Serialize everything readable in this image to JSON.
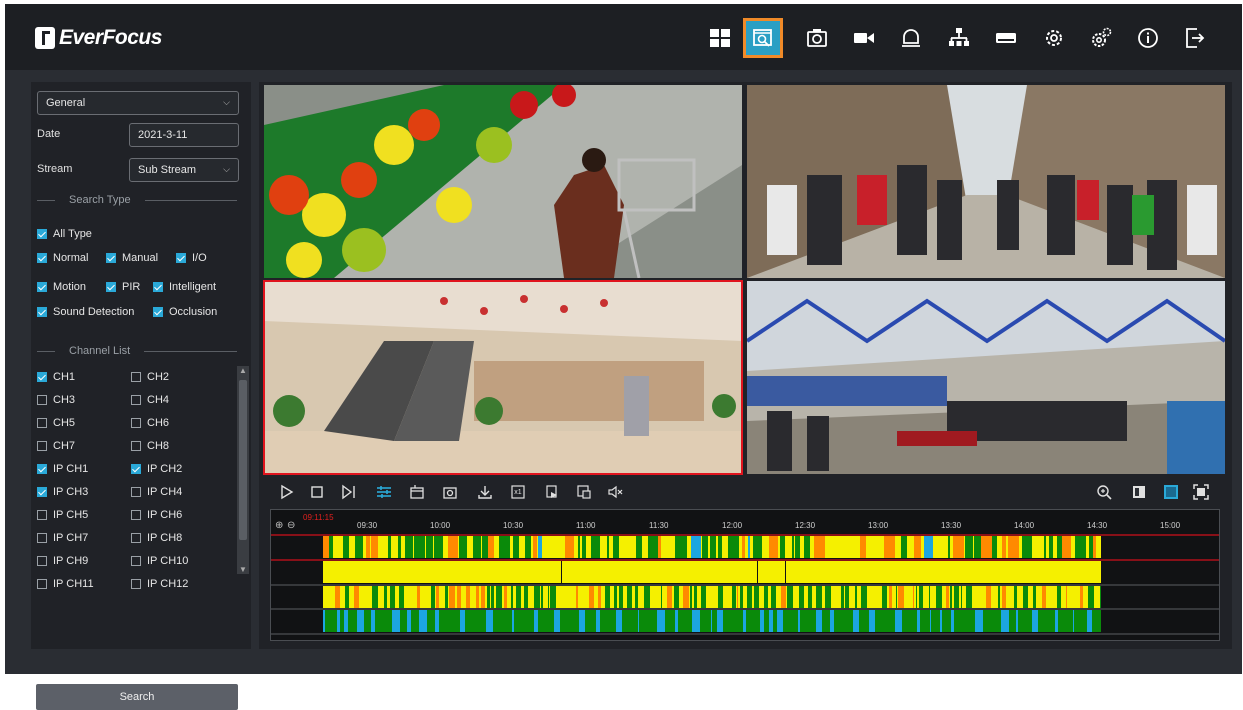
{
  "brand": {
    "name": "EverFocus"
  },
  "nav": {
    "icons": [
      "layout-icon",
      "playback-icon",
      "snapshot-icon",
      "record-icon",
      "alarm-icon",
      "network-icon",
      "storage-icon",
      "settings-icon",
      "advanced-settings-icon",
      "info-icon",
      "logout-icon"
    ],
    "active": "playback-icon",
    "active_color": "#2a9fc4",
    "highlight_color": "#f08a28"
  },
  "sidebar": {
    "mode": "General",
    "date_label": "Date",
    "date_value": "2021-3-11",
    "stream_label": "Stream",
    "stream_value": "Sub Stream",
    "search_type_header": "Search Type",
    "all_type": "All Type",
    "types": [
      {
        "label": "Normal",
        "checked": true
      },
      {
        "label": "Manual",
        "checked": true
      },
      {
        "label": "I/O",
        "checked": true
      },
      {
        "label": "Motion",
        "checked": true
      },
      {
        "label": "PIR",
        "checked": true
      },
      {
        "label": "Intelligent",
        "checked": true
      },
      {
        "label": "Sound Detection",
        "checked": true
      },
      {
        "label": "Occlusion",
        "checked": true
      }
    ],
    "channel_header": "Channel List",
    "channels": [
      {
        "label": "CH1",
        "checked": true
      },
      {
        "label": "CH2",
        "checked": false
      },
      {
        "label": "CH3",
        "checked": false
      },
      {
        "label": "CH4",
        "checked": false
      },
      {
        "label": "CH5",
        "checked": false
      },
      {
        "label": "CH6",
        "checked": false
      },
      {
        "label": "CH7",
        "checked": false
      },
      {
        "label": "CH8",
        "checked": false
      },
      {
        "label": "IP CH1",
        "checked": true
      },
      {
        "label": "IP CH2",
        "checked": true
      },
      {
        "label": "IP CH3",
        "checked": true
      },
      {
        "label": "IP CH4",
        "checked": false
      },
      {
        "label": "IP CH5",
        "checked": false
      },
      {
        "label": "IP CH6",
        "checked": false
      },
      {
        "label": "IP CH7",
        "checked": false
      },
      {
        "label": "IP CH8",
        "checked": false
      },
      {
        "label": "IP CH9",
        "checked": false
      },
      {
        "label": "IP CH10",
        "checked": false
      },
      {
        "label": "IP CH11",
        "checked": false
      },
      {
        "label": "IP CH12",
        "checked": false
      }
    ],
    "search_button": "Search"
  },
  "views": [
    "supermarket-produce",
    "street-crowd",
    "mall-escalator",
    "airport-terminal"
  ],
  "selected_view": "mall-escalator",
  "toolbar": {
    "left_icons": [
      "play-icon",
      "stop-icon",
      "step-frame-icon",
      "event-filter-icon",
      "clip-icon",
      "snapshot-icon",
      "download-icon",
      "speed-x1-icon",
      "export-icon",
      "backup-icon",
      "mute-icon"
    ],
    "speed_label": "x1",
    "right_icons": [
      "zoom-icon",
      "single-view-icon",
      "quad-view-icon",
      "fullscreen-icon"
    ]
  },
  "timeline": {
    "current_time": "09:11:15",
    "ticks": [
      "09:30",
      "10:00",
      "10:30",
      "11:00",
      "11:30",
      "12:00",
      "12:30",
      "13:00",
      "13:30",
      "14:00",
      "14:30",
      "15:00"
    ],
    "rows": 4,
    "colors": {
      "normal": "#f5f000",
      "motion": "#0a8a0a",
      "io": "#ff8a00",
      "intelligent": "#1ca6e0",
      "cursor": "#d0101a"
    }
  }
}
